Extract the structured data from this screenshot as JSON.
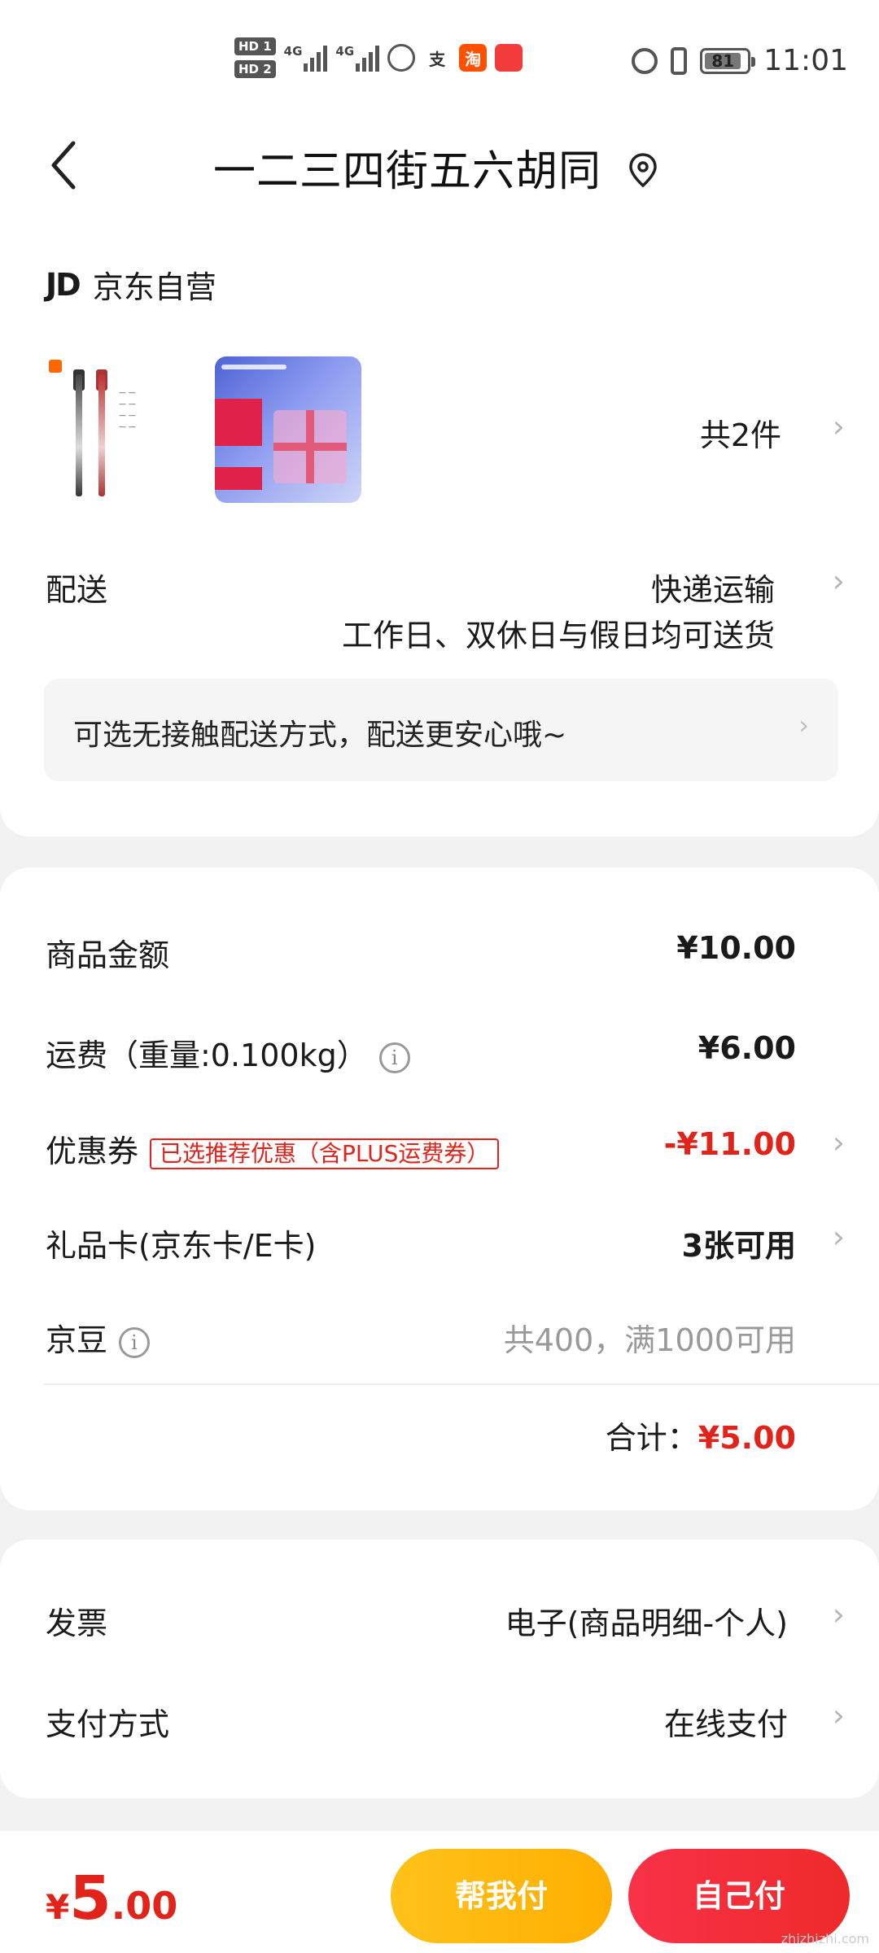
{
  "status_bar": {
    "hd1": "HD 1",
    "hd2": "HD 2",
    "network1": "4G",
    "network2": "4G",
    "app_zhi": "支",
    "app_tao": "淘",
    "battery": "81",
    "time": "11:01"
  },
  "header": {
    "title": "一二三四街五六胡同"
  },
  "store": {
    "logo": "JD",
    "name": "京东自营"
  },
  "products": {
    "count_label": "共2件"
  },
  "delivery": {
    "label": "配送",
    "method": "快递运输",
    "schedule": "工作日、双休日与假日均可送货",
    "notice": "可选无接触配送方式，配送更安心哦~"
  },
  "costs": {
    "goods_label": "商品金额",
    "goods_value": "¥10.00",
    "shipping_label": "运费（重量:0.100kg）",
    "shipping_value": "¥6.00",
    "coupon_label": "优惠券",
    "coupon_tag": "已选推荐优惠（含PLUS运费券）",
    "coupon_value": "-¥11.00",
    "giftcard_label": "礼品卡(京东卡/E卡)",
    "giftcard_value": "3张可用",
    "jingdou_label": "京豆",
    "jingdou_value": "共400，满1000可用",
    "total_label": "合计：",
    "total_value": "¥5.00"
  },
  "invoice": {
    "label": "发票",
    "value": "电子(商品明细-个人)"
  },
  "payment": {
    "label": "支付方式",
    "value": "在线支付"
  },
  "bottom": {
    "price_yen": "¥",
    "price_int": "5",
    "price_dec": ".00",
    "help_pay": "帮我付",
    "self_pay": "自己付",
    "watermark": "zhizhizhi.com"
  },
  "colors": {
    "accent_red": "#e2231a",
    "help_btn": "#ffb80a",
    "self_btn": "#f5303f"
  }
}
